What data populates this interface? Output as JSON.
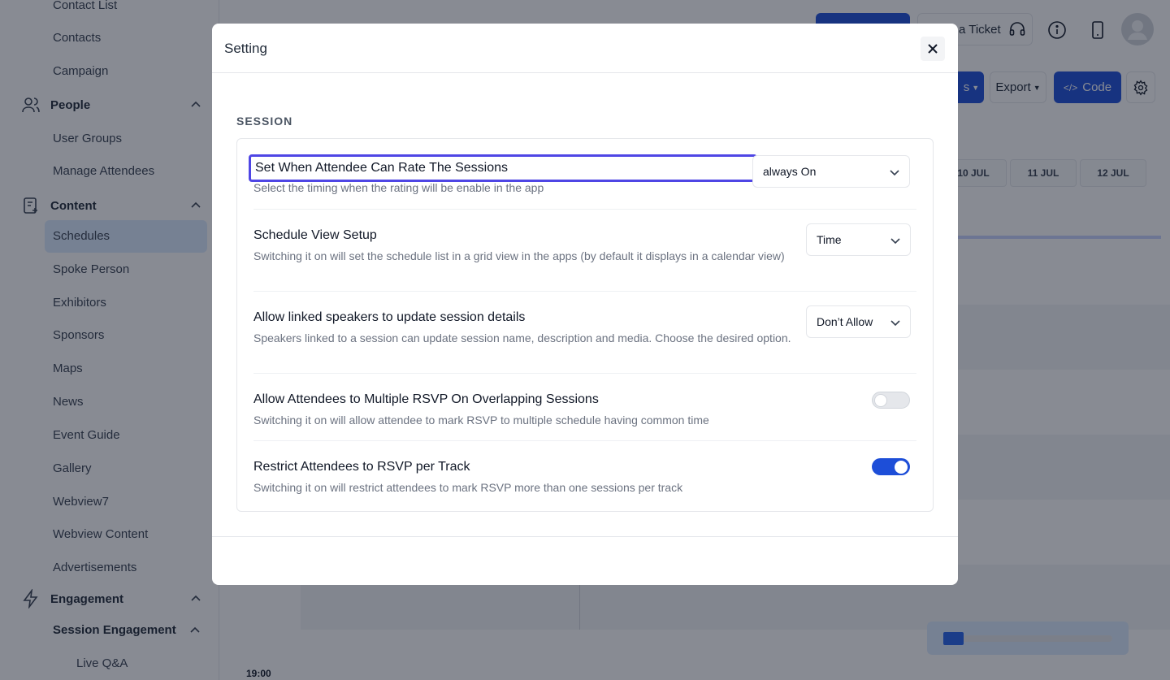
{
  "sidebar": {
    "items": {
      "contact_list": "Contact List",
      "contacts": "Contacts",
      "campaign": "Campaign",
      "people": "People",
      "user_groups": "User Groups",
      "manage_attendees": "Manage Attendees",
      "content": "Content",
      "schedules": "Schedules",
      "spoke_person": "Spoke Person",
      "exhibitors": "Exhibitors",
      "sponsors": "Sponsors",
      "maps": "Maps",
      "news": "News",
      "event_guide": "Event Guide",
      "gallery": "Gallery",
      "webview7": "Webview7",
      "webview_content": "Webview Content",
      "advertisements": "Advertisements",
      "engagement": "Engagement",
      "session_engagement": "Session Engagement",
      "live_qa": "Live Q&A"
    }
  },
  "topbar": {
    "ticket_label": "a Ticket"
  },
  "toolbar": {
    "partial_label": "s",
    "export_label": "Export",
    "code_label": "Code"
  },
  "schedule": {
    "dates": [
      "10 JUL",
      "11 JUL",
      "12 JUL"
    ],
    "time_label": "19:00"
  },
  "progress": {
    "value": 0.12
  },
  "modal": {
    "title": "Setting",
    "section_title": "SESSION",
    "settings": [
      {
        "title": "Set When Attendee Can Rate The Sessions",
        "description": "Select the timing when the rating will be enable in the app",
        "control": "select",
        "value": "always On"
      },
      {
        "title": "Schedule View Setup",
        "description": "Switching it on will set the schedule list in a grid view in the apps (by default it displays in a calendar view)",
        "control": "select",
        "value": "Time"
      },
      {
        "title": "Allow linked speakers to update session details",
        "description": "Speakers linked to a session can update session name, description and media. Choose the desired option.",
        "control": "select",
        "value": "Don’t Allow"
      },
      {
        "title": "Allow Attendees to Multiple RSVP On Overlapping Sessions",
        "description": "Switching it on will allow attendee to mark RSVP to multiple schedule having common time",
        "control": "toggle",
        "value": false
      },
      {
        "title": "Restrict Attendees to RSVP per Track",
        "description": "Switching it on will restrict attendees to mark RSVP more than one sessions per track",
        "control": "toggle",
        "value": true
      }
    ]
  },
  "colors": {
    "accent": "#1d4ed8",
    "focus_ring": "#4f46e5",
    "overlay": "#111827"
  },
  "icons": {
    "people": "users-icon",
    "content": "document-plus-icon",
    "engagement": "lightning-icon",
    "close": "close-icon"
  }
}
